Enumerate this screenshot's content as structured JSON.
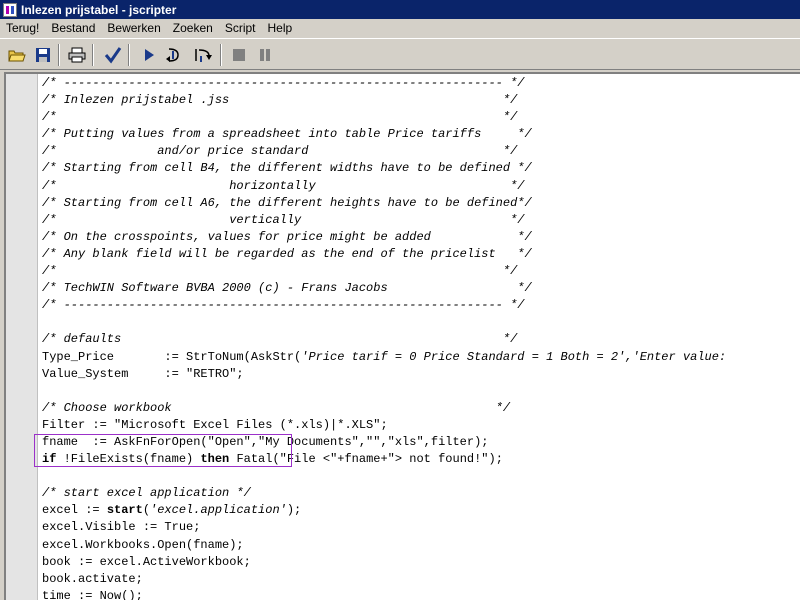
{
  "window": {
    "title": "Inlezen prijstabel - jscripter"
  },
  "menu": [
    "Terug!",
    "Bestand",
    "Bewerken",
    "Zoeken",
    "Script",
    "Help"
  ],
  "toolbar": {
    "icons": [
      "open-folder-icon",
      "save-disk-icon",
      "print-icon",
      "check-syntax-icon",
      "run-play-icon",
      "step-into-icon",
      "step-over-icon",
      "stop-icon",
      "pause-icon"
    ]
  },
  "code": {
    "lines": [
      [
        {
          "t": "/* ------------------------------------------------------------- */",
          "s": "c"
        }
      ],
      [
        {
          "t": "/* Inlezen prijstabel .jss                                      */",
          "s": "c"
        }
      ],
      [
        {
          "t": "/*                                                              */",
          "s": "c"
        }
      ],
      [
        {
          "t": "/* Putting values from a spreadsheet into table Price tariffs     */",
          "s": "c"
        }
      ],
      [
        {
          "t": "/*              and/or price standard                           */",
          "s": "c"
        }
      ],
      [
        {
          "t": "/* Starting from cell B4, the different widths have to be defined */",
          "s": "c"
        }
      ],
      [
        {
          "t": "/*                        horizontally                           */",
          "s": "c"
        }
      ],
      [
        {
          "t": "/* Starting from cell A6, the different heights have to be defined*/",
          "s": "c"
        }
      ],
      [
        {
          "t": "/*                        vertically                             */",
          "s": "c"
        }
      ],
      [
        {
          "t": "/* On the crosspoints, values for price might be added            */",
          "s": "c"
        }
      ],
      [
        {
          "t": "/* Any blank field will be regarded as the end of the pricelist   */",
          "s": "c"
        }
      ],
      [
        {
          "t": "/*                                                              */",
          "s": "c"
        }
      ],
      [
        {
          "t": "/* TechWIN Software BVBA 2000 (c) - Frans Jacobs                  */",
          "s": "c"
        }
      ],
      [
        {
          "t": "/* ------------------------------------------------------------- */",
          "s": "c"
        }
      ],
      [
        {
          "t": "",
          "s": ""
        }
      ],
      [
        {
          "t": "/* defaults                                                     */",
          "s": "c"
        }
      ],
      [
        {
          "t": "Type_Price       := StrToNum(AskStr(",
          "s": ""
        },
        {
          "t": "'Price tarif = 0 Price Standard = 1 Both = 2','Enter value:",
          "s": "str"
        }
      ],
      [
        {
          "t": "Value_System     := \"RETRO\";",
          "s": ""
        }
      ],
      [
        {
          "t": "",
          "s": ""
        }
      ],
      [
        {
          "t": "/* Choose workbook                                             */",
          "s": "c"
        }
      ],
      [
        {
          "t": "Filter := \"Microsoft Excel Files (*.xls)|*.XLS\";",
          "s": ""
        }
      ],
      [
        {
          "t": "fname  := AskFnForOpen(\"Open\",\"My Documents\",\"\",\"xls\",filter);",
          "s": ""
        }
      ],
      [
        {
          "t": "if",
          "s": "kw"
        },
        {
          "t": " !FileExists(fname) ",
          "s": ""
        },
        {
          "t": "then",
          "s": "kw"
        },
        {
          "t": " Fatal(\"File <\"+fname+\"> not found!\");",
          "s": ""
        }
      ],
      [
        {
          "t": "",
          "s": ""
        }
      ],
      [
        {
          "t": "/* start excel application */",
          "s": "c"
        }
      ],
      [
        {
          "t": "excel := ",
          "s": ""
        },
        {
          "t": "start",
          "s": "kw"
        },
        {
          "t": "(",
          "s": ""
        },
        {
          "t": "'excel.application'",
          "s": "str"
        },
        {
          "t": ");",
          "s": ""
        }
      ],
      [
        {
          "t": "excel.Visible := True;",
          "s": ""
        }
      ],
      [
        {
          "t": "excel.Workbooks.Open(fname);",
          "s": ""
        }
      ],
      [
        {
          "t": "book := excel.ActiveWorkbook;",
          "s": ""
        }
      ],
      [
        {
          "t": "book.activate;",
          "s": ""
        }
      ],
      [
        {
          "t": "time := Now();",
          "s": ""
        }
      ]
    ]
  }
}
